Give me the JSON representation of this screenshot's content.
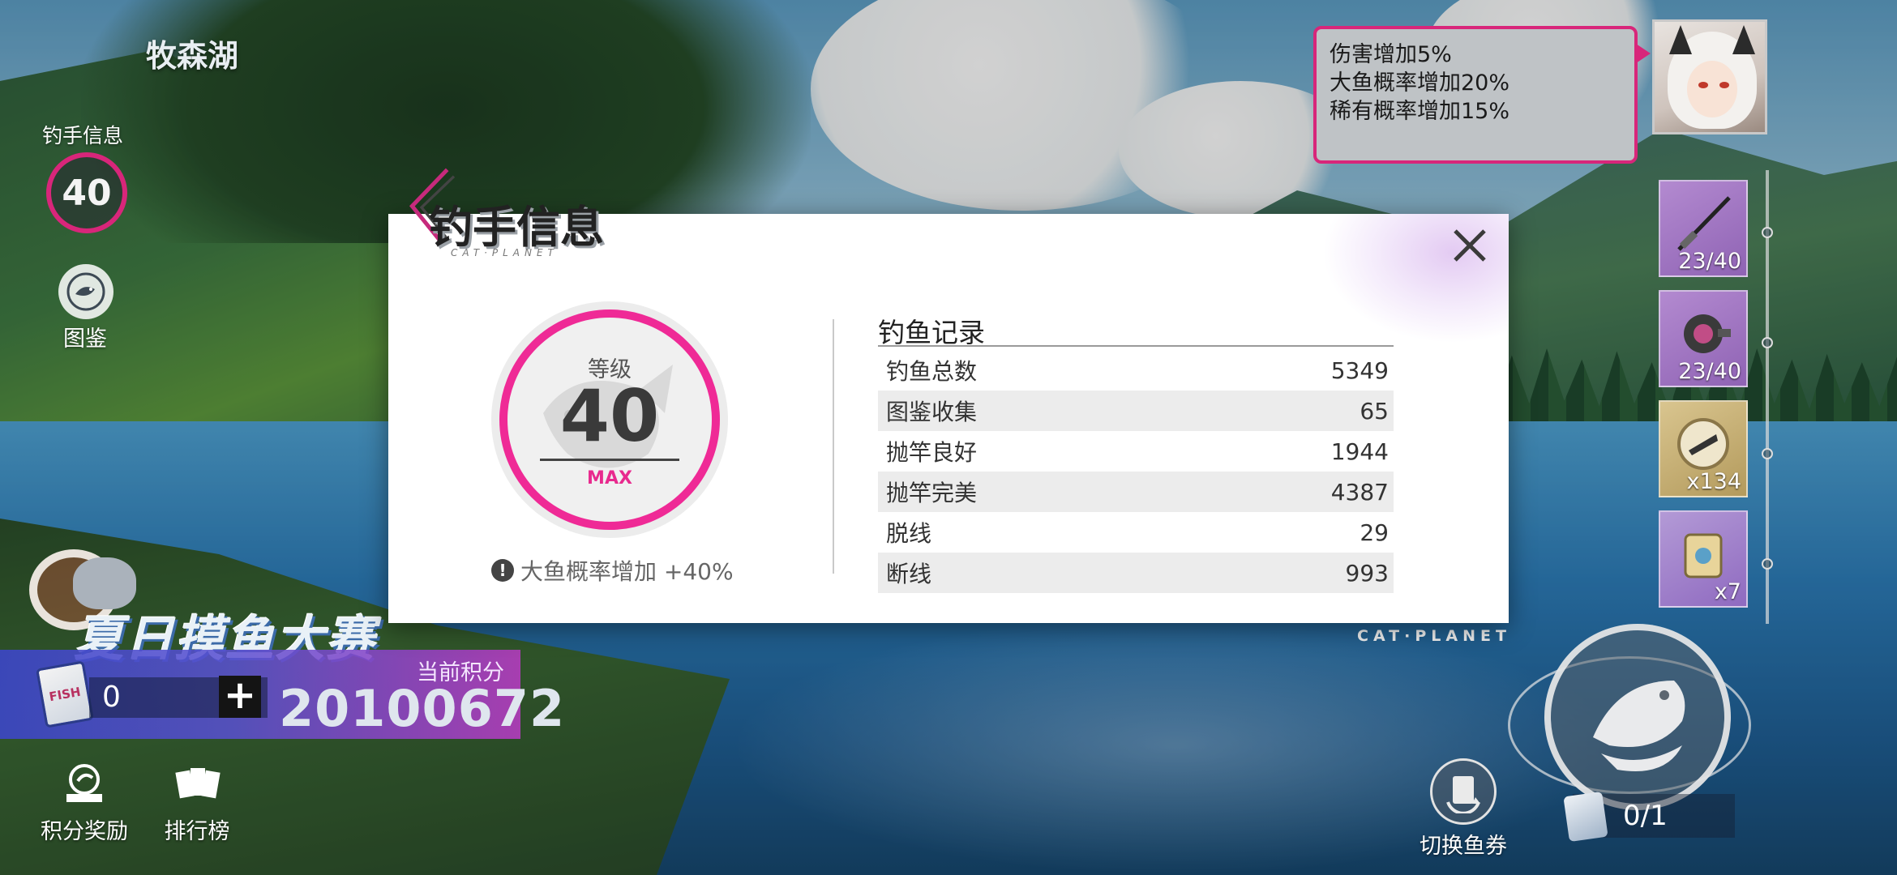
{
  "hud": {
    "location": "牧森湖",
    "angler_label": "钓手信息",
    "angler_level": "40",
    "codex_label": "图鉴"
  },
  "buffs": {
    "lines": [
      "伤害增加5%",
      "大鱼概率增加20%",
      "稀有概率增加15%"
    ]
  },
  "equipment": [
    {
      "icon": "fishing-rod-icon",
      "count": "23/40"
    },
    {
      "icon": "reel-icon",
      "count": "23/40"
    },
    {
      "icon": "lure-icon",
      "count": "x134"
    },
    {
      "icon": "bait-bag-icon",
      "count": "x7"
    }
  ],
  "event": {
    "title": "夏日摸鱼大赛",
    "tickets": "0",
    "plus": "+",
    "points_label": "当前积分",
    "points": "20100672",
    "ticket_badge": "FISH"
  },
  "bottom_buttons": {
    "rewards": "积分奖励",
    "ranking": "排行榜",
    "switch_ticket": "切换鱼券"
  },
  "cast": {
    "ticket_count": "0/1",
    "brand": "CAT·PLANET"
  },
  "modal": {
    "title": "钓手信息",
    "subtitle": "CAT·PLANET",
    "level_caption": "等级",
    "level": "40",
    "level_max": "MAX",
    "bonus_icon": "!",
    "bonus": "大鱼概率增加 +40%",
    "records_title": "钓鱼记录",
    "records": [
      {
        "label": "钓鱼总数",
        "value": "5349"
      },
      {
        "label": "图鉴收集",
        "value": "65"
      },
      {
        "label": "抛竿良好",
        "value": "1944"
      },
      {
        "label": "抛竿完美",
        "value": "4387"
      },
      {
        "label": "脱线",
        "value": "29"
      },
      {
        "label": "断线",
        "value": "993"
      }
    ]
  },
  "colors": {
    "accent_pink": "#ef2a96",
    "badge_border": "#d8267a",
    "modal_bg": "#ffffff"
  }
}
